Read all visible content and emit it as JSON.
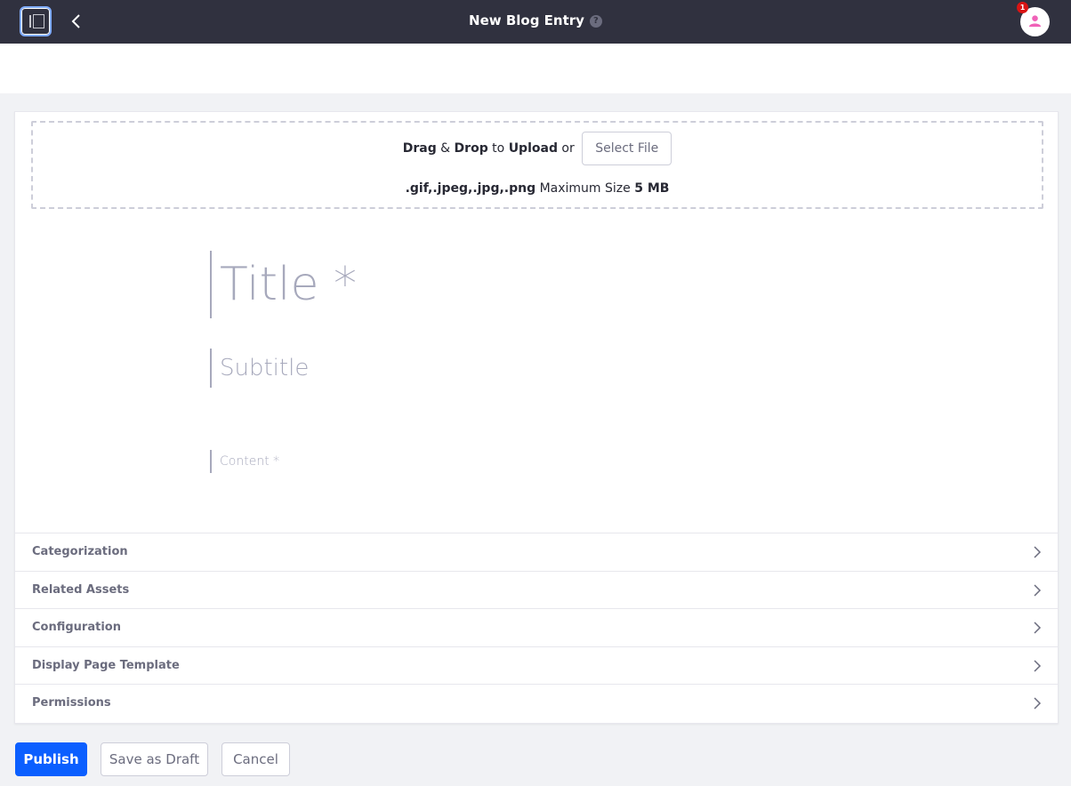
{
  "header": {
    "title": "New Blog Entry",
    "help_glyph": "?",
    "notification_count": "1",
    "icons": {
      "toggle": "product-menu-toggle-icon",
      "back": "chevron-left-icon",
      "help": "question-circle-icon",
      "avatar": "user-icon"
    }
  },
  "upload": {
    "drag": "Drag",
    "amp": "&",
    "drop": "Drop",
    "to": "to",
    "upload": "Upload",
    "or": "or",
    "select_file_label": "Select File",
    "formats": ".gif,.jpeg,.jpg,.png",
    "max_size_label": "Maximum Size",
    "max_size_value": "5 MB"
  },
  "editor": {
    "title_placeholder": "Title *",
    "subtitle_placeholder": "Subtitle",
    "content_placeholder": "Content *"
  },
  "panels": [
    {
      "label": "Categorization"
    },
    {
      "label": "Related Assets"
    },
    {
      "label": "Configuration"
    },
    {
      "label": "Display Page Template"
    },
    {
      "label": "Permissions"
    }
  ],
  "actions": {
    "publish": "Publish",
    "save_draft": "Save as Draft",
    "cancel": "Cancel"
  },
  "colors": {
    "topbar": "#30313f",
    "primary": "#0b5fff",
    "badge": "#da1414",
    "avatar_icon": "#f062b8"
  }
}
